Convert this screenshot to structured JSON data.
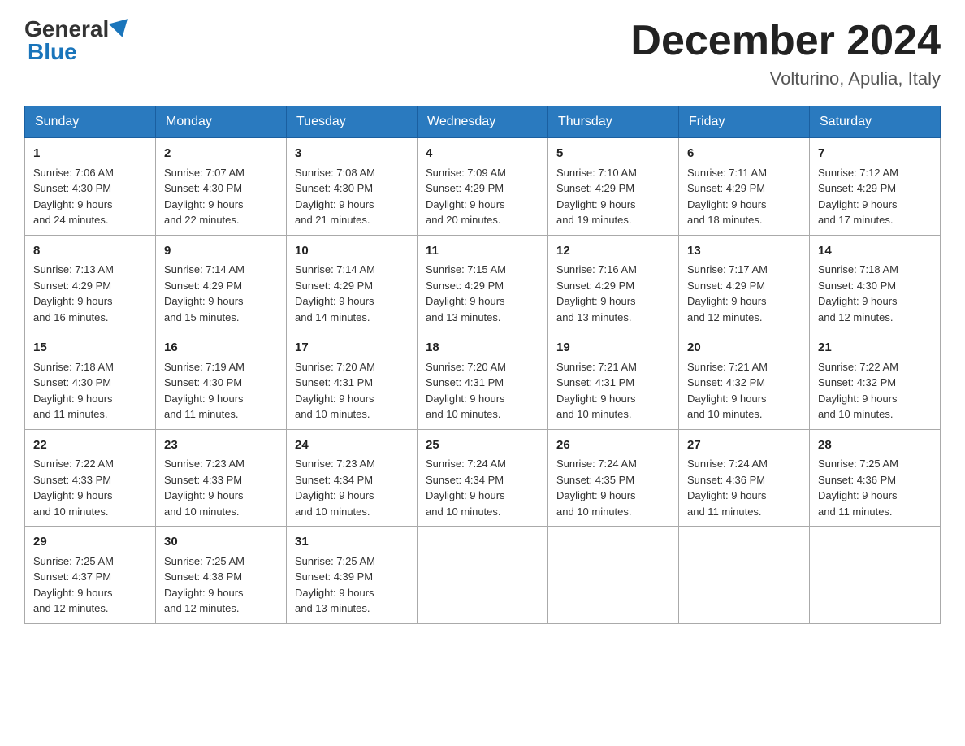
{
  "header": {
    "logo_general": "General",
    "logo_blue": "Blue",
    "title": "December 2024",
    "subtitle": "Volturino, Apulia, Italy"
  },
  "weekdays": [
    "Sunday",
    "Monday",
    "Tuesday",
    "Wednesday",
    "Thursday",
    "Friday",
    "Saturday"
  ],
  "weeks": [
    [
      {
        "day": "1",
        "sunrise": "7:06 AM",
        "sunset": "4:30 PM",
        "daylight": "9 hours and 24 minutes."
      },
      {
        "day": "2",
        "sunrise": "7:07 AM",
        "sunset": "4:30 PM",
        "daylight": "9 hours and 22 minutes."
      },
      {
        "day": "3",
        "sunrise": "7:08 AM",
        "sunset": "4:30 PM",
        "daylight": "9 hours and 21 minutes."
      },
      {
        "day": "4",
        "sunrise": "7:09 AM",
        "sunset": "4:29 PM",
        "daylight": "9 hours and 20 minutes."
      },
      {
        "day": "5",
        "sunrise": "7:10 AM",
        "sunset": "4:29 PM",
        "daylight": "9 hours and 19 minutes."
      },
      {
        "day": "6",
        "sunrise": "7:11 AM",
        "sunset": "4:29 PM",
        "daylight": "9 hours and 18 minutes."
      },
      {
        "day": "7",
        "sunrise": "7:12 AM",
        "sunset": "4:29 PM",
        "daylight": "9 hours and 17 minutes."
      }
    ],
    [
      {
        "day": "8",
        "sunrise": "7:13 AM",
        "sunset": "4:29 PM",
        "daylight": "9 hours and 16 minutes."
      },
      {
        "day": "9",
        "sunrise": "7:14 AM",
        "sunset": "4:29 PM",
        "daylight": "9 hours and 15 minutes."
      },
      {
        "day": "10",
        "sunrise": "7:14 AM",
        "sunset": "4:29 PM",
        "daylight": "9 hours and 14 minutes."
      },
      {
        "day": "11",
        "sunrise": "7:15 AM",
        "sunset": "4:29 PM",
        "daylight": "9 hours and 13 minutes."
      },
      {
        "day": "12",
        "sunrise": "7:16 AM",
        "sunset": "4:29 PM",
        "daylight": "9 hours and 13 minutes."
      },
      {
        "day": "13",
        "sunrise": "7:17 AM",
        "sunset": "4:29 PM",
        "daylight": "9 hours and 12 minutes."
      },
      {
        "day": "14",
        "sunrise": "7:18 AM",
        "sunset": "4:30 PM",
        "daylight": "9 hours and 12 minutes."
      }
    ],
    [
      {
        "day": "15",
        "sunrise": "7:18 AM",
        "sunset": "4:30 PM",
        "daylight": "9 hours and 11 minutes."
      },
      {
        "day": "16",
        "sunrise": "7:19 AM",
        "sunset": "4:30 PM",
        "daylight": "9 hours and 11 minutes."
      },
      {
        "day": "17",
        "sunrise": "7:20 AM",
        "sunset": "4:31 PM",
        "daylight": "9 hours and 10 minutes."
      },
      {
        "day": "18",
        "sunrise": "7:20 AM",
        "sunset": "4:31 PM",
        "daylight": "9 hours and 10 minutes."
      },
      {
        "day": "19",
        "sunrise": "7:21 AM",
        "sunset": "4:31 PM",
        "daylight": "9 hours and 10 minutes."
      },
      {
        "day": "20",
        "sunrise": "7:21 AM",
        "sunset": "4:32 PM",
        "daylight": "9 hours and 10 minutes."
      },
      {
        "day": "21",
        "sunrise": "7:22 AM",
        "sunset": "4:32 PM",
        "daylight": "9 hours and 10 minutes."
      }
    ],
    [
      {
        "day": "22",
        "sunrise": "7:22 AM",
        "sunset": "4:33 PM",
        "daylight": "9 hours and 10 minutes."
      },
      {
        "day": "23",
        "sunrise": "7:23 AM",
        "sunset": "4:33 PM",
        "daylight": "9 hours and 10 minutes."
      },
      {
        "day": "24",
        "sunrise": "7:23 AM",
        "sunset": "4:34 PM",
        "daylight": "9 hours and 10 minutes."
      },
      {
        "day": "25",
        "sunrise": "7:24 AM",
        "sunset": "4:34 PM",
        "daylight": "9 hours and 10 minutes."
      },
      {
        "day": "26",
        "sunrise": "7:24 AM",
        "sunset": "4:35 PM",
        "daylight": "9 hours and 10 minutes."
      },
      {
        "day": "27",
        "sunrise": "7:24 AM",
        "sunset": "4:36 PM",
        "daylight": "9 hours and 11 minutes."
      },
      {
        "day": "28",
        "sunrise": "7:25 AM",
        "sunset": "4:36 PM",
        "daylight": "9 hours and 11 minutes."
      }
    ],
    [
      {
        "day": "29",
        "sunrise": "7:25 AM",
        "sunset": "4:37 PM",
        "daylight": "9 hours and 12 minutes."
      },
      {
        "day": "30",
        "sunrise": "7:25 AM",
        "sunset": "4:38 PM",
        "daylight": "9 hours and 12 minutes."
      },
      {
        "day": "31",
        "sunrise": "7:25 AM",
        "sunset": "4:39 PM",
        "daylight": "9 hours and 13 minutes."
      },
      null,
      null,
      null,
      null
    ]
  ],
  "labels": {
    "sunrise_prefix": "Sunrise: ",
    "sunset_prefix": "Sunset: ",
    "daylight_prefix": "Daylight: "
  }
}
